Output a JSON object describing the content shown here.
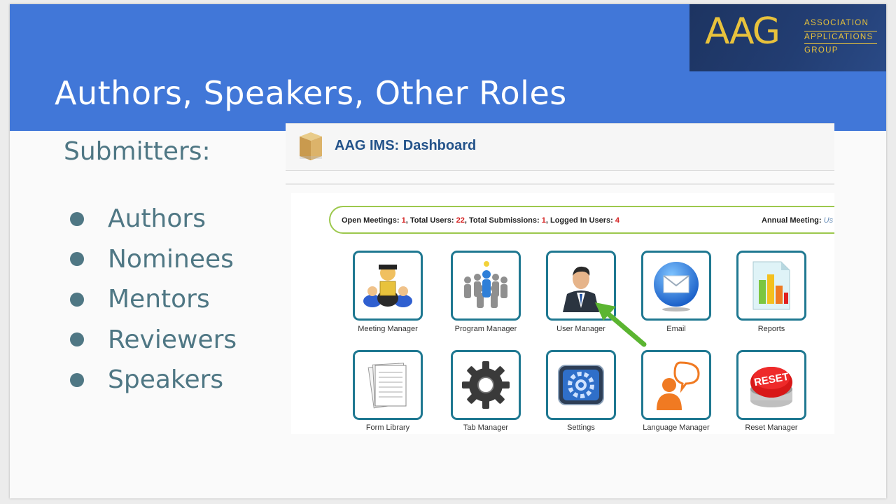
{
  "slide": {
    "title": "Authors, Speakers, Other Roles",
    "subheading": "Submitters:",
    "roles": [
      "Authors",
      "Nominees",
      "Mentors",
      "Reviewers",
      "Speakers"
    ]
  },
  "logo": {
    "mark": "AAG",
    "lines": [
      "ASSOCIATION",
      "APPLICATIONS",
      "GROUP"
    ]
  },
  "dashboard": {
    "title": "AAG IMS: Dashboard",
    "stats": {
      "open_meetings_label": "Open Meetings:",
      "open_meetings": "1",
      "total_users_label": "Total Users:",
      "total_users": "22",
      "total_submissions_label": "Total Submissions:",
      "total_submissions": "1",
      "logged_in_label": "Logged In Users:",
      "logged_in": "4",
      "annual_meeting_label": "Annual Meeting:",
      "annual_meeting_value": "Us"
    },
    "tiles": [
      {
        "label": "Meeting Manager",
        "icon": "meeting-manager-icon"
      },
      {
        "label": "Program Manager",
        "icon": "program-manager-icon"
      },
      {
        "label": "User Manager",
        "icon": "user-manager-icon"
      },
      {
        "label": "Email",
        "icon": "email-icon"
      },
      {
        "label": "Reports",
        "icon": "reports-icon"
      },
      {
        "label": "Form Library",
        "icon": "form-library-icon"
      },
      {
        "label": "Tab Manager",
        "icon": "tab-manager-icon"
      },
      {
        "label": "Settings",
        "icon": "settings-icon"
      },
      {
        "label": "Language Manager",
        "icon": "language-manager-icon"
      },
      {
        "label": "Reset Manager",
        "icon": "reset-manager-icon"
      }
    ],
    "reset_badge": "RESET"
  },
  "colors": {
    "header_blue": "#4177d8",
    "text_teal": "#4f7784",
    "logo_gold": "#e8c23c",
    "tile_border": "#1f7891",
    "stats_border": "#9cc84c",
    "stat_number": "#d42020",
    "arrow_green": "#5bb531"
  }
}
